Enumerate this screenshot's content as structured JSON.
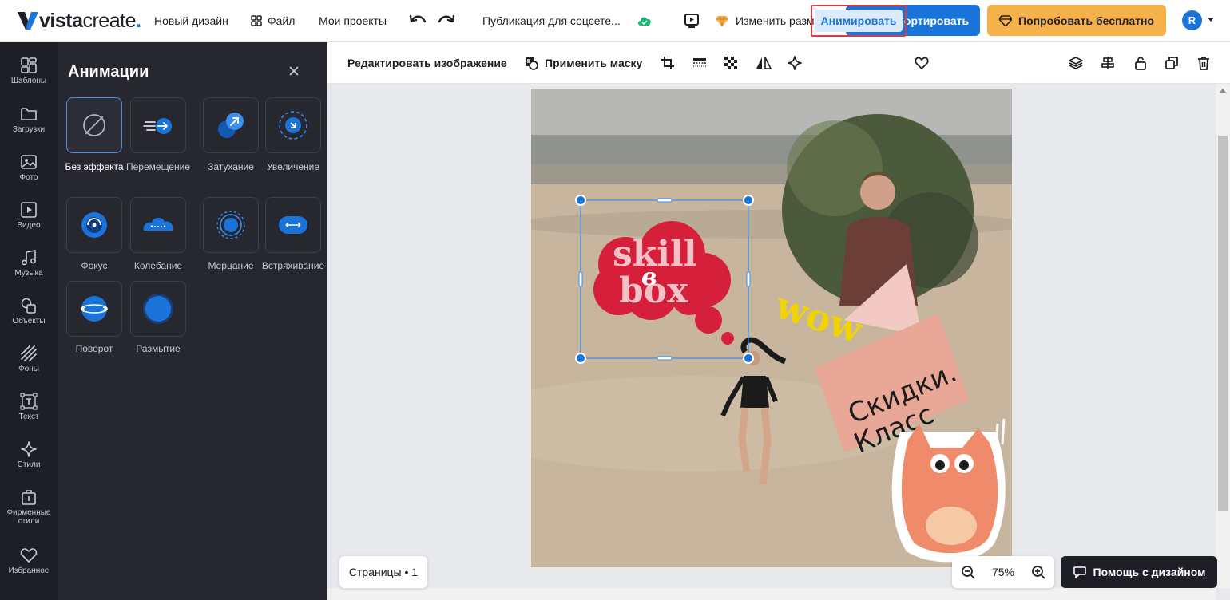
{
  "app": {
    "logo_bold": "vista",
    "logo_light": "create",
    "logo_mark": "."
  },
  "topbar": {
    "new_design": "Новый дизайн",
    "file": "Файл",
    "my_projects": "Мои проекты",
    "doc_title": "Публикация для соцсете...",
    "resize": "Изменить размер",
    "export": "Экспортировать",
    "try_free": "Попробовать бесплатно",
    "avatar_letter": "R",
    "colors": {
      "export": "#1a73d9",
      "try": "#f7b14a",
      "sync": "#1fb876"
    }
  },
  "rail": {
    "items": [
      {
        "label": "Шаблоны",
        "icon": "templates-icon"
      },
      {
        "label": "Загрузки",
        "icon": "folder-icon"
      },
      {
        "label": "Фото",
        "icon": "photo-icon"
      },
      {
        "label": "Видео",
        "icon": "video-icon"
      },
      {
        "label": "Музыка",
        "icon": "music-icon"
      },
      {
        "label": "Объекты",
        "icon": "objects-icon"
      },
      {
        "label": "Фоны",
        "icon": "backgrounds-icon"
      },
      {
        "label": "Текст",
        "icon": "text-icon"
      },
      {
        "label": "Стили",
        "icon": "styles-icon"
      },
      {
        "label": "Фирменные стили",
        "icon": "brand-icon"
      },
      {
        "label": "Избранное",
        "icon": "heart-icon"
      }
    ]
  },
  "panel": {
    "title": "Анимации",
    "animations": [
      {
        "label": "Без эффекта",
        "icon": "none-icon",
        "selected": true
      },
      {
        "label": "Перемещение",
        "icon": "move-icon"
      },
      {
        "label": "Затухание",
        "icon": "fade-icon"
      },
      {
        "label": "Увеличение",
        "icon": "zoom-in-icon"
      },
      {
        "label": "Фокус",
        "icon": "focus-icon"
      },
      {
        "label": "Колебание",
        "icon": "wobble-icon"
      },
      {
        "label": "Мерцание",
        "icon": "flicker-icon"
      },
      {
        "label": "Встряхивание",
        "icon": "shake-icon"
      },
      {
        "label": "Поворот",
        "icon": "rotate-icon"
      },
      {
        "label": "Размытие",
        "icon": "blur-icon"
      }
    ]
  },
  "toolbar": {
    "edit_image": "Редактировать изображение",
    "apply_mask": "Применить маску",
    "animate": "Анимировать"
  },
  "design": {
    "bubble_line1": "skill",
    "bubble_line2": "box",
    "bubble_mark": "в",
    "wow": "wow",
    "sale_line1": "Скидки.",
    "sale_line2": "Класс"
  },
  "bottom": {
    "pages": "Страницы • 1",
    "zoom": "75%",
    "help": "Помощь с дизайном"
  }
}
